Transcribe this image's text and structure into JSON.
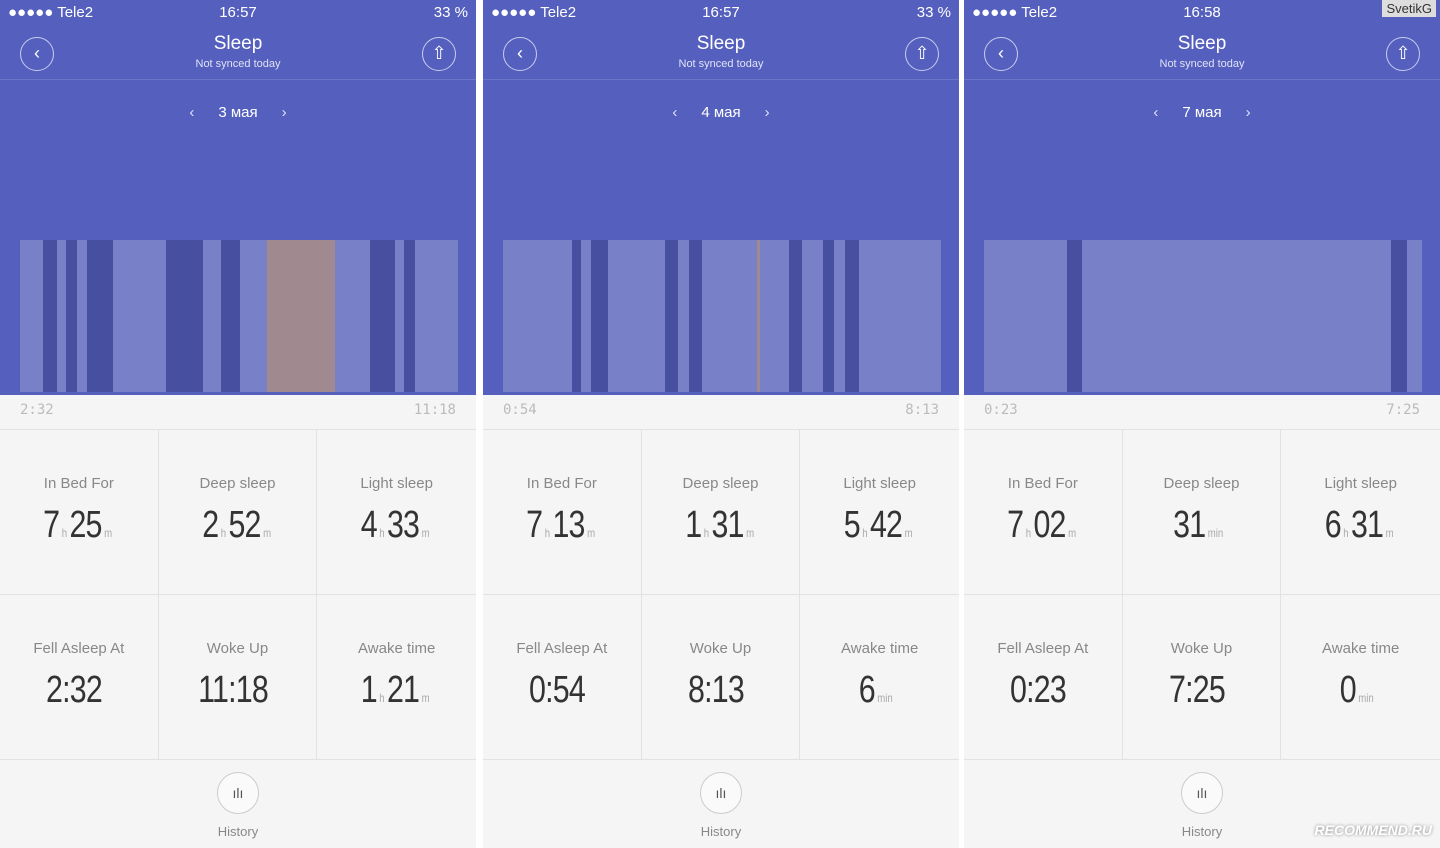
{
  "colors": {
    "header": "#5560be",
    "light": "#7880c8",
    "deep": "#4750a0",
    "awake": "#a08a90"
  },
  "panels": [
    {
      "status": {
        "carrier": "●●●●● Tele2",
        "time": "16:57",
        "battery": "33 %"
      },
      "title": "Sleep",
      "subtitle": "Not synced today",
      "date": "3 мая",
      "start": "2:32",
      "end": "11:18",
      "stats": [
        {
          "label": "In Bed For",
          "v1": "7",
          "u1": "h",
          "v2": "25",
          "u2": "m"
        },
        {
          "label": "Deep sleep",
          "v1": "2",
          "u1": "h",
          "v2": "52",
          "u2": "m"
        },
        {
          "label": "Light sleep",
          "v1": "4",
          "u1": "h",
          "v2": "33",
          "u2": "m"
        },
        {
          "label": "Fell Asleep At",
          "v1": "2:32",
          "u1": "",
          "v2": "",
          "u2": ""
        },
        {
          "label": "Woke Up",
          "v1": "11:18",
          "u1": "",
          "v2": "",
          "u2": ""
        },
        {
          "label": "Awake time",
          "v1": "1",
          "u1": "h",
          "v2": "21",
          "u2": "m"
        }
      ],
      "segments": [
        [
          "light",
          23
        ],
        [
          "deep",
          14
        ],
        [
          "light",
          9
        ],
        [
          "deep",
          11
        ],
        [
          "light",
          10
        ],
        [
          "deep",
          26
        ],
        [
          "light",
          53
        ],
        [
          "deep",
          37
        ],
        [
          "light",
          18
        ],
        [
          "deep",
          19
        ],
        [
          "light",
          27
        ],
        [
          "awake",
          68
        ],
        [
          "light",
          35
        ],
        [
          "deep",
          25
        ],
        [
          "light",
          9
        ],
        [
          "deep",
          11
        ],
        [
          "light",
          43
        ]
      ],
      "history": "History"
    },
    {
      "status": {
        "carrier": "●●●●● Tele2",
        "time": "16:57",
        "battery": "33 %"
      },
      "title": "Sleep",
      "subtitle": "Not synced today",
      "date": "4 мая",
      "start": "0:54",
      "end": "8:13",
      "stats": [
        {
          "label": "In Bed For",
          "v1": "7",
          "u1": "h",
          "v2": "13",
          "u2": "m"
        },
        {
          "label": "Deep sleep",
          "v1": "1",
          "u1": "h",
          "v2": "31",
          "u2": "m"
        },
        {
          "label": "Light sleep",
          "v1": "5",
          "u1": "h",
          "v2": "42",
          "u2": "m"
        },
        {
          "label": "Fell Asleep At",
          "v1": "0:54",
          "u1": "",
          "v2": "",
          "u2": ""
        },
        {
          "label": "Woke Up",
          "v1": "8:13",
          "u1": "",
          "v2": "",
          "u2": ""
        },
        {
          "label": "Awake time",
          "v1": "6",
          "u1": "min",
          "v2": "",
          "u2": ""
        }
      ],
      "segments": [
        [
          "light",
          69
        ],
        [
          "deep",
          9
        ],
        [
          "light",
          10
        ],
        [
          "deep",
          17
        ],
        [
          "light",
          57
        ],
        [
          "deep",
          13
        ],
        [
          "light",
          11
        ],
        [
          "deep",
          13
        ],
        [
          "light",
          54
        ],
        [
          "awake",
          3
        ],
        [
          "light",
          29
        ],
        [
          "deep",
          13
        ],
        [
          "light",
          21
        ],
        [
          "deep",
          11
        ],
        [
          "light",
          11
        ],
        [
          "deep",
          14
        ],
        [
          "light",
          82
        ]
      ],
      "history": "History"
    },
    {
      "status": {
        "carrier": "●●●●● Tele2",
        "time": "16:58",
        "battery": "33 %"
      },
      "title": "Sleep",
      "subtitle": "Not synced today",
      "date": "7 мая",
      "start": "0:23",
      "end": "7:25",
      "stats": [
        {
          "label": "In Bed For",
          "v1": "7",
          "u1": "h",
          "v2": "02",
          "u2": "m"
        },
        {
          "label": "Deep sleep",
          "v1": "31",
          "u1": "min",
          "v2": "",
          "u2": ""
        },
        {
          "label": "Light sleep",
          "v1": "6",
          "u1": "h",
          "v2": "31",
          "u2": "m"
        },
        {
          "label": "Fell Asleep At",
          "v1": "0:23",
          "u1": "",
          "v2": "",
          "u2": ""
        },
        {
          "label": "Woke Up",
          "v1": "7:25",
          "u1": "",
          "v2": "",
          "u2": ""
        },
        {
          "label": "Awake time",
          "v1": "0",
          "u1": "min",
          "v2": "",
          "u2": ""
        }
      ],
      "segments": [
        [
          "light",
          83
        ],
        [
          "deep",
          15
        ],
        [
          "light",
          307
        ],
        [
          "deep",
          16
        ],
        [
          "light",
          15
        ]
      ],
      "history": "History"
    }
  ],
  "watermark": "SvetikG",
  "recommend": "RECOMMEND.RU"
}
